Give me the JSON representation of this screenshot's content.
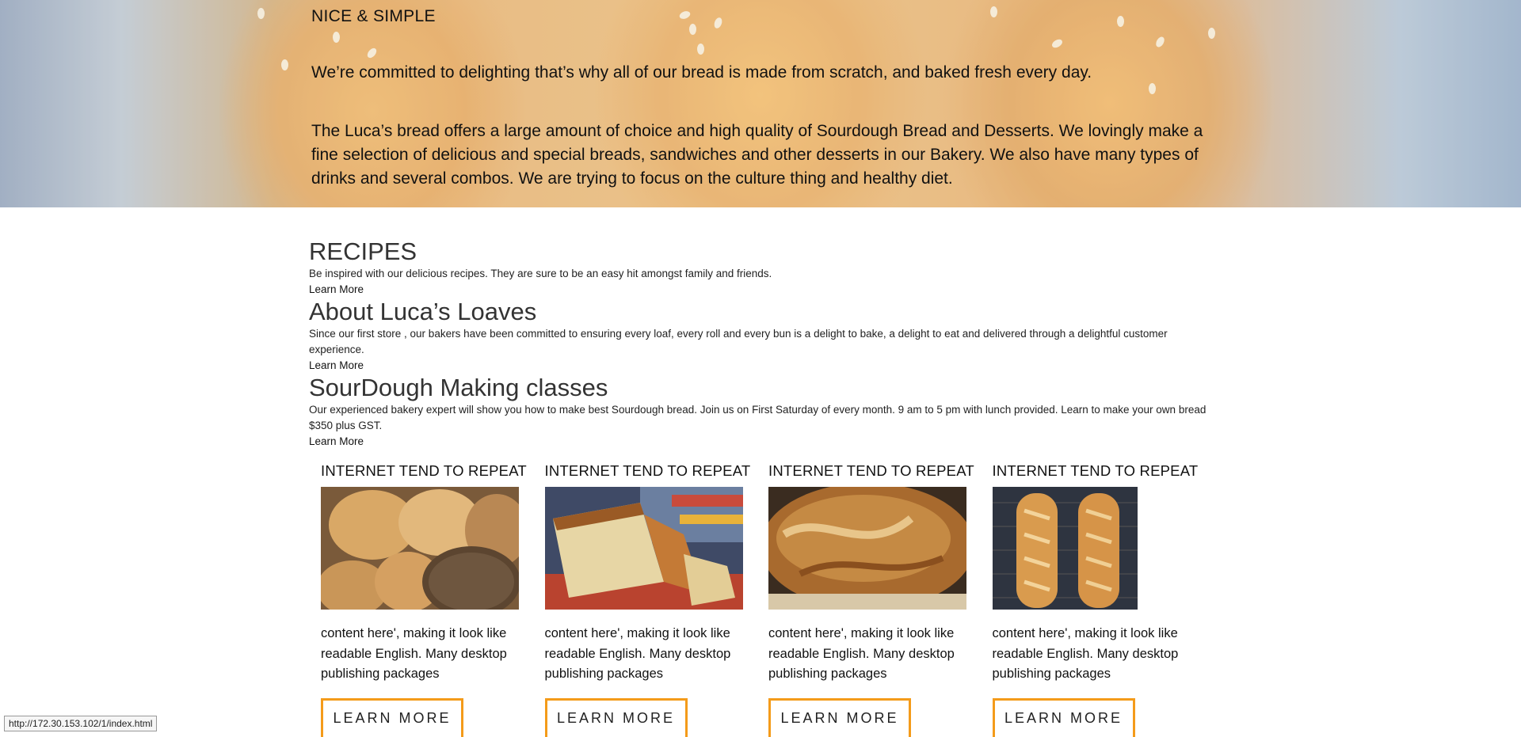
{
  "hero": {
    "kicker": "NICE & SIMPLE",
    "p1": "We’re committed to delighting that’s why all of our bread is made from scratch, and baked fresh every day.",
    "p2": "The Luca’s bread offers a large amount of choice and high quality of Sourdough Bread and Desserts. We lovingly make a fine selection of delicious and special breads, sandwiches and other desserts in our Bakery. We also have many types of drinks and several combos. We are trying to focus on the culture thing and healthy diet."
  },
  "sections": [
    {
      "title": "RECIPES",
      "text": "Be inspired with our delicious recipes. They are sure to be an easy hit amongst family and friends.",
      "link": "Learn More"
    },
    {
      "title": "About Luca’s Loaves",
      "text": "Since our first store , our bakers have been committed to ensuring every loaf, every roll and every bun is a delight to bake, a delight to eat and delivered through a delightful customer experience.",
      "link": "Learn More"
    },
    {
      "title": "SourDough Making classes",
      "text": "Our experienced bakery expert will show you how to make best Sourdough bread. Join us on First Saturday of every month. 9 am to 5 pm with lunch provided. Learn to make your own bread $350 plus GST.",
      "link": "Learn More"
    }
  ],
  "cards": [
    {
      "title": "INTERNET TEND TO REPEAT",
      "text": "content here', making it look like readable English. Many desktop publishing packages",
      "button": "LEARN MORE",
      "image": "bread-rolls"
    },
    {
      "title": "INTERNET TEND TO REPEAT",
      "text": "content here', making it look like readable English. Many desktop publishing packages",
      "button": "LEARN MORE",
      "image": "sliced-loaf"
    },
    {
      "title": "INTERNET TEND TO REPEAT",
      "text": "content here', making it look like readable English. Many desktop publishing packages",
      "button": "LEARN MORE",
      "image": "rustic-bread"
    },
    {
      "title": "INTERNET TEND TO REPEAT",
      "text": "content here', making it look like readable English. Many desktop publishing packages",
      "button": "LEARN MORE",
      "image": "baguettes"
    }
  ],
  "status_url": "http://172.30.153.102/1/index.html",
  "colors": {
    "button_border": "#f49b1a",
    "hero_bun": "#e8b772"
  }
}
